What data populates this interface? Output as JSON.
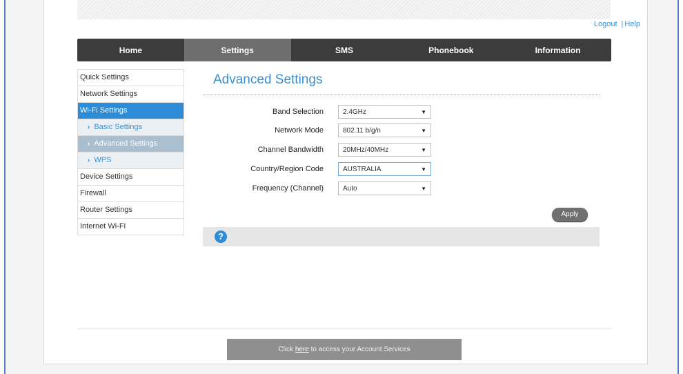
{
  "header": {
    "logout": "Logout",
    "separator": "|",
    "help": "Help"
  },
  "nav": [
    "Home",
    "Settings",
    "SMS",
    "Phonebook",
    "Information"
  ],
  "nav_active": "Settings",
  "sidebar": {
    "items": [
      "Quick Settings",
      "Network Settings",
      "Wi-Fi Settings"
    ],
    "subitems": [
      "Basic Settings",
      "Advanced Settings",
      "WPS"
    ],
    "items_after": [
      "Device Settings",
      "Firewall",
      "Router Settings",
      "Internet Wi-Fi"
    ]
  },
  "content": {
    "title": "Advanced Settings",
    "fields": [
      {
        "label": "Band Selection",
        "value": "2.4GHz"
      },
      {
        "label": "Network Mode",
        "value": "802.11 b/g/n"
      },
      {
        "label": "Channel Bandwidth",
        "value": "20MHz/40MHz"
      },
      {
        "label": "Country/Region Code",
        "value": "AUSTRALIA"
      },
      {
        "label": "Frequency (Channel)",
        "value": "Auto"
      }
    ],
    "apply": "Apply",
    "help_icon": "?"
  },
  "footer": {
    "prefix": "Click ",
    "link": "here",
    "suffix": " to access your Account Services"
  },
  "colors": {
    "accent": "#2e8bd6",
    "nav_bg": "#3c3c3c",
    "nav_active": "#6e6e6e"
  },
  "icons": {
    "chevron": "chevron-right-icon",
    "dropdown": "dropdown-arrow-icon",
    "help": "help-circle-icon"
  }
}
